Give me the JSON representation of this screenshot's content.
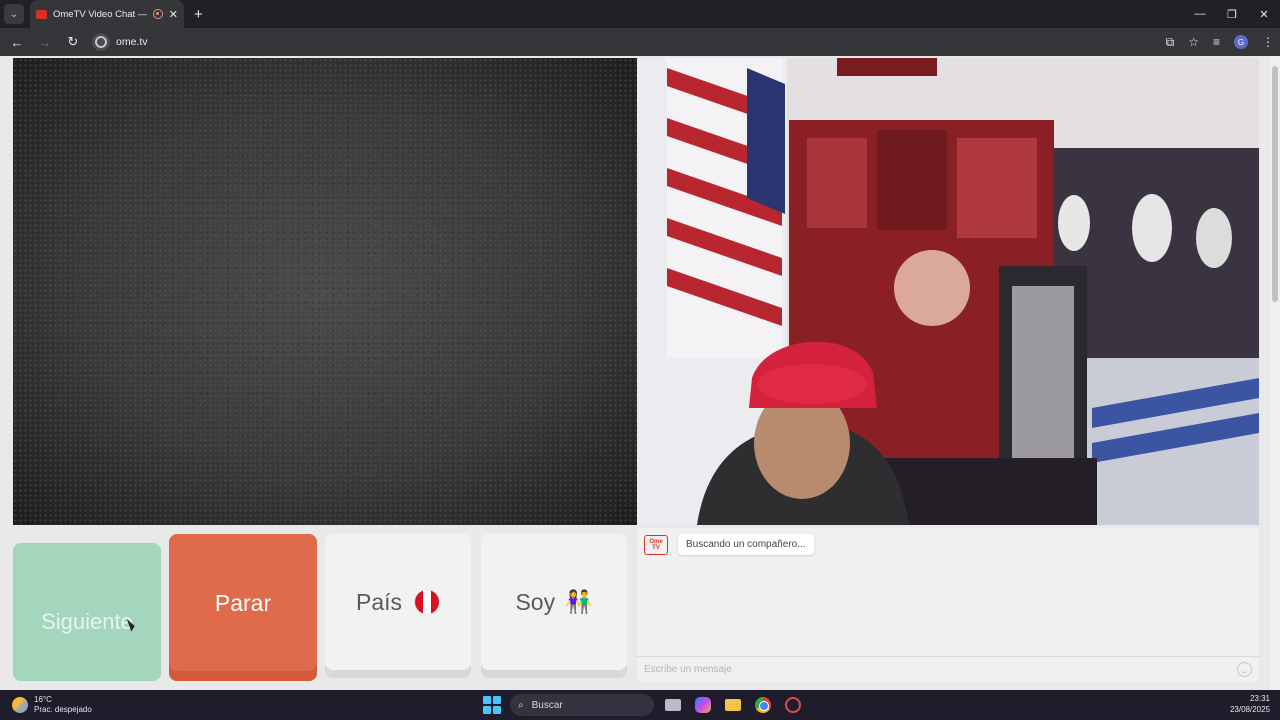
{
  "browser": {
    "tab_title": "OmeTV Video Chat — Ome",
    "url": "ome.tv",
    "profile_initial": "G",
    "new_tab_glyph": "+",
    "close_tab_glyph": "✕",
    "window_minimize": "—",
    "window_restore": "❐",
    "window_close": "✕",
    "icons": [
      "tab-list-icon",
      "recording-icon",
      "back-icon",
      "forward-icon",
      "reload-icon",
      "site-info-icon",
      "cast-icon",
      "bookmark-star-icon",
      "reading-list-icon",
      "menu-icon"
    ]
  },
  "controls": {
    "next_label": "Siguiente",
    "stop_label": "Parar",
    "country_label": "País",
    "country_flag": "Peru",
    "gender_label": "Soy",
    "gender_emoji": "👫"
  },
  "chat": {
    "logo_text": "Ome TV",
    "status_message": "Buscando un compañero...",
    "input_placeholder": "Escribe un mensaje"
  },
  "taskbar": {
    "temperature": "16°C",
    "weather_desc": "Prac. despejado",
    "search_label": "Buscar",
    "time": "23:31",
    "date": "23/08/2025",
    "apps": [
      "task-view-icon",
      "copilot-icon",
      "file-explorer-icon",
      "chrome-icon",
      "ometv-app-icon"
    ]
  },
  "colors": {
    "next_button": "#a3d6bd",
    "stop_button": "#e06a4c",
    "option_button": "#f3f2f3",
    "brand_red": "#d93025"
  }
}
